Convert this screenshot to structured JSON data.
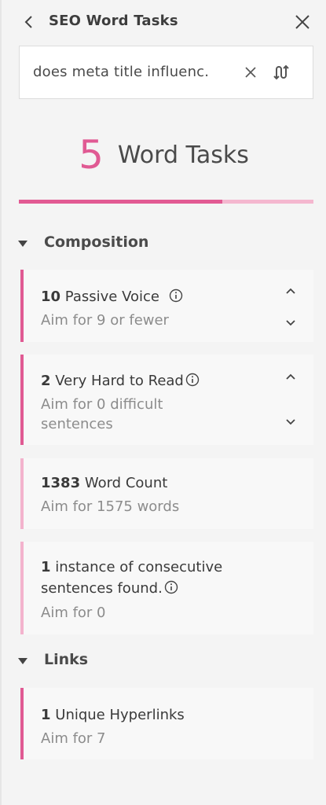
{
  "header": {
    "title": "SEO Word Tasks",
    "back_icon": "chevron-left-icon",
    "close_icon": "close-icon"
  },
  "search": {
    "value": "does meta title influenc.",
    "clear_icon": "clear-x-icon",
    "swap_icon": "swap-icon"
  },
  "summary": {
    "count": "5",
    "label": "Word Tasks",
    "progress_fraction": 0.69
  },
  "sections": {
    "composition": {
      "label": "Composition",
      "cards": [
        {
          "count": "10",
          "title": "Passive Voice",
          "sub": "Aim for 9 or fewer"
        },
        {
          "count": "2",
          "title": "Very Hard to Read",
          "sub_line1": "Aim for 0 difficult",
          "sub_line2": "sentences"
        },
        {
          "count": "1383",
          "title": "Word Count",
          "sub": "Aim for 1575 words"
        },
        {
          "count": "1",
          "title_line1": "instance of consecutive",
          "title_line2": "sentences found.",
          "sub": "Aim for 0"
        }
      ]
    },
    "links": {
      "label": "Links",
      "cards": [
        {
          "count": "1",
          "title": "Unique Hyperlinks",
          "sub": "Aim for 7"
        }
      ]
    }
  },
  "colors": {
    "accent": "#e05a93",
    "accent_light": "#f3b3cd",
    "background": "#f4f4f4"
  }
}
